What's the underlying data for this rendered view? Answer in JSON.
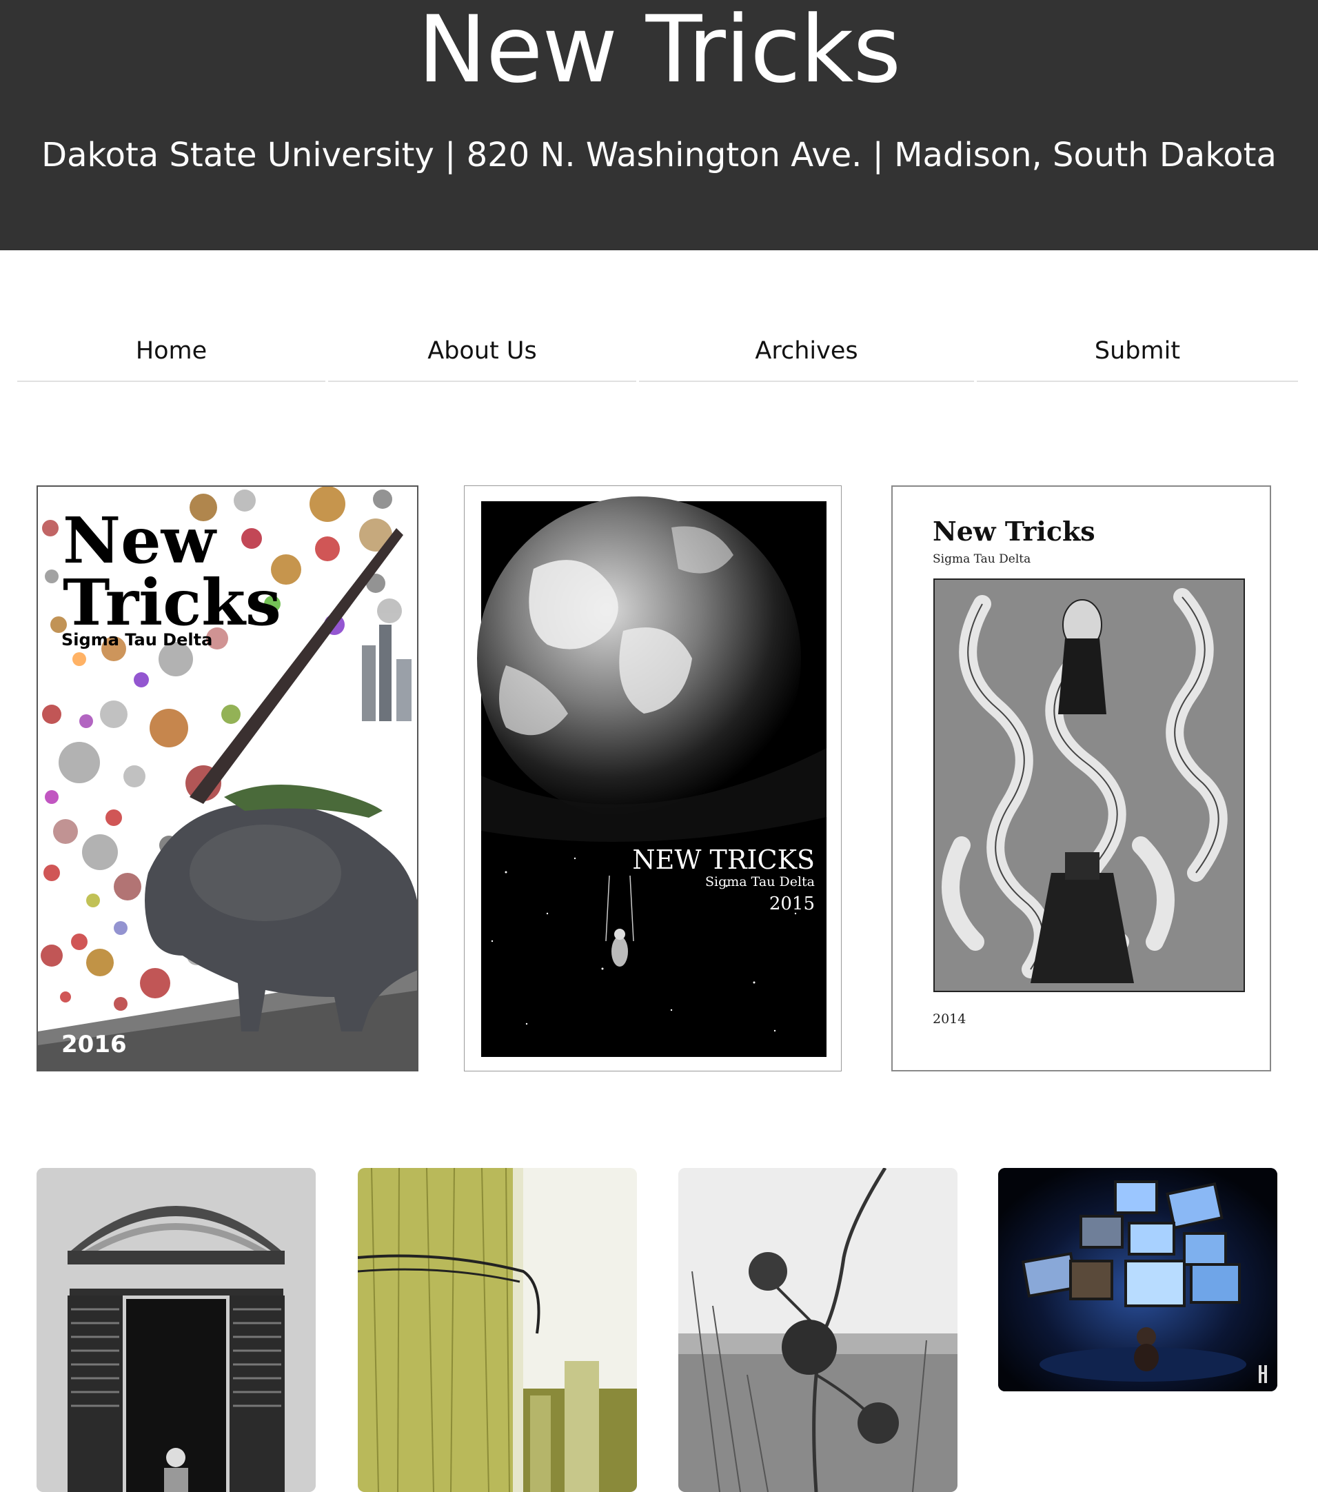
{
  "header": {
    "title": "New Tricks",
    "subtitle": "Dakota State University | 820 N. Washington Ave. | Madison, South Dakota"
  },
  "nav": {
    "home": "Home",
    "about": "About Us",
    "archives": "Archives",
    "submit": "Submit"
  },
  "covers": {
    "c2016": {
      "title_line1": "New",
      "title_line2": "Tricks",
      "org": "Sigma Tau Delta",
      "year": "2016"
    },
    "c2015": {
      "title": "NEW TRICKS",
      "org": "Sigma Tau Delta",
      "year": "2015"
    },
    "c2014": {
      "title": "New Tricks",
      "org": "Sigma Tau Delta",
      "year": "2014"
    }
  },
  "colors": {
    "header_bg": "#333333",
    "nav_rule": "#e0e0e0"
  }
}
